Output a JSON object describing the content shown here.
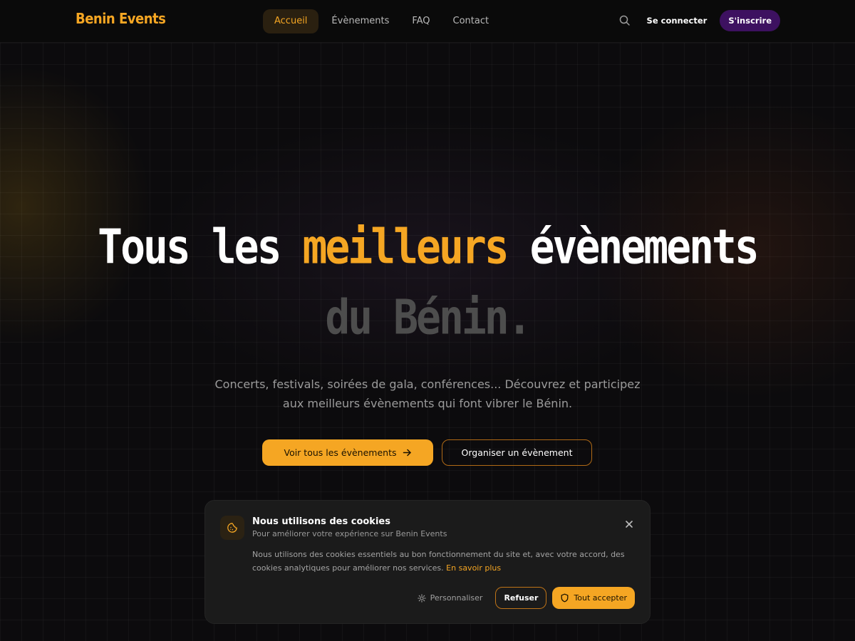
{
  "header": {
    "logo": "Benin Events",
    "nav": [
      {
        "label": "Accueil",
        "active": true
      },
      {
        "label": "Évènements",
        "active": false
      },
      {
        "label": "FAQ",
        "active": false
      },
      {
        "label": "Contact",
        "active": false
      }
    ],
    "search_icon": "search-icon",
    "login_label": "Se connecter",
    "signup_label": "S'inscrire"
  },
  "hero": {
    "title_part1": "Tous les ",
    "title_highlight": "meilleurs",
    "title_part2": " évènements",
    "title_line2": "du Bénin.",
    "subtitle_line1": "Concerts, festivals, soirées de gala, conférences... Découvrez et participez",
    "subtitle_line2": "aux meilleurs évènements qui font vibrer le Bénin.",
    "primary_cta": "Voir tous les évènements",
    "secondary_cta": "Organiser un évènement"
  },
  "cookie_banner": {
    "title": "Nous utilisons des cookies",
    "subtitle": "Pour améliorer votre expérience sur Benin Events",
    "text": "Nous utilisons des cookies essentiels au bon fonctionnement du site et, avec votre accord, des cookies analytiques pour améliorer nos services.",
    "link": "En savoir plus",
    "customize_label": "Personnaliser",
    "refuse_label": "Refuser",
    "accept_label": "Tout accepter"
  },
  "colors": {
    "accent": "#f5a623",
    "signup_bg": "#3d1160",
    "background": "#0b0a0b"
  }
}
